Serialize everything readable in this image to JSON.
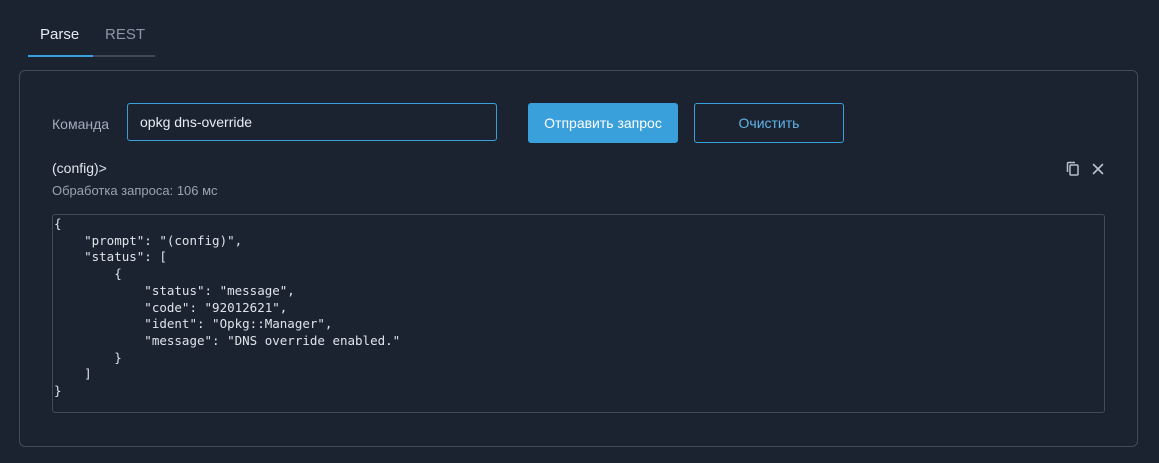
{
  "tabs": [
    {
      "label": "Parse",
      "active": true
    },
    {
      "label": "REST",
      "active": false
    }
  ],
  "command": {
    "label": "Команда",
    "value": "opkg dns-override"
  },
  "buttons": {
    "send_label": "Отправить запрос",
    "clear_label": "Очистить"
  },
  "result": {
    "prompt": "(config)>",
    "timing": "Обработка запроса: 106 мс",
    "output": "{\n    \"prompt\": \"(config)\",\n    \"status\": [\n        {\n            \"status\": \"message\",\n            \"code\": \"92012621\",\n            \"ident\": \"Opkg::Manager\",\n            \"message\": \"DNS override enabled.\"\n        }\n    ]\n}"
  },
  "icons": {
    "copy": "copy-icon",
    "close": "close-icon"
  },
  "colors": {
    "background": "#1b2331",
    "accent": "#3aa0db",
    "border": "#414b5b"
  }
}
